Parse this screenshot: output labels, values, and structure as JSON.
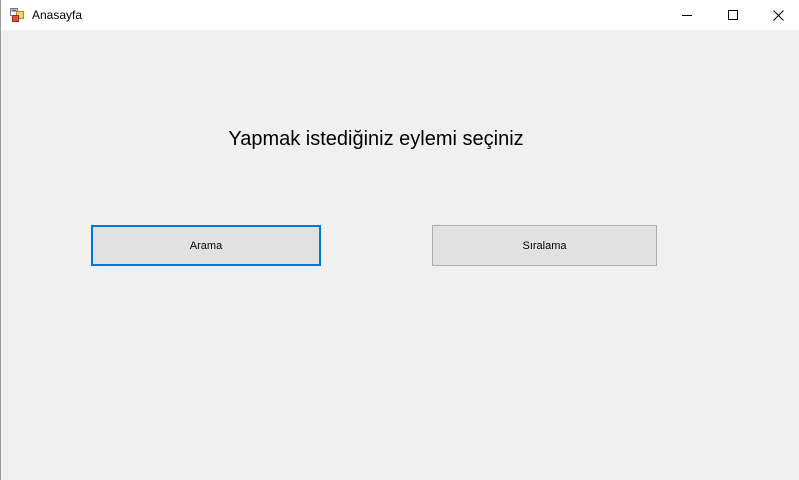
{
  "window": {
    "title": "Anasayfa",
    "icon": "form-icon",
    "controls": [
      "minimize-icon",
      "maximize-icon",
      "close-icon"
    ]
  },
  "main": {
    "heading": "Yapmak istediğiniz eylemi seçiniz",
    "buttons": [
      {
        "label": "Arama",
        "focused": true
      },
      {
        "label": "Sıralama",
        "focused": false
      }
    ]
  },
  "colors": {
    "background": "#f0f0f0",
    "button_face": "#e1e1e1",
    "focus_border": "#0078d7"
  }
}
